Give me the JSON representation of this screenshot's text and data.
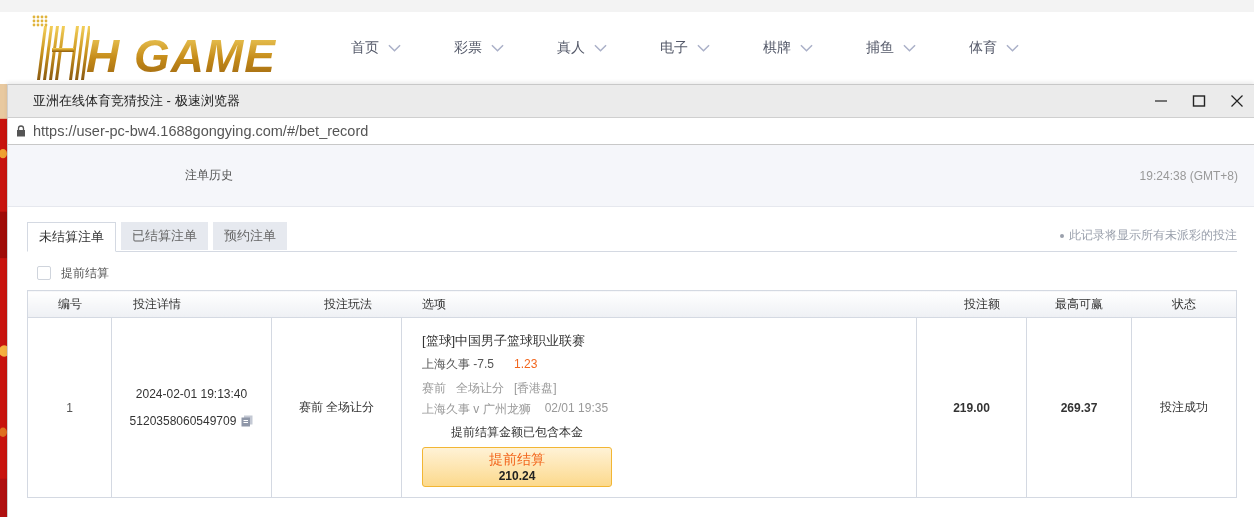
{
  "site_header": {
    "logo_text": "H GAME",
    "nav": [
      {
        "label": "首页"
      },
      {
        "label": "彩票"
      },
      {
        "label": "真人"
      },
      {
        "label": "电子"
      },
      {
        "label": "棋牌"
      },
      {
        "label": "捕鱼"
      },
      {
        "label": "体育"
      }
    ]
  },
  "window": {
    "title": "亚洲在线体育竞猜投注 - 极速浏览器",
    "url": "https://user-pc-bw4.1688gongying.com/#/bet_record"
  },
  "page": {
    "title": "注单历史",
    "clock": "19:24:38 (GMT+8)",
    "tabs": [
      {
        "label": "未结算注单",
        "selected": true
      },
      {
        "label": "已结算注单",
        "selected": false
      },
      {
        "label": "预约注单",
        "selected": false
      }
    ],
    "note": "此记录将显示所有未派彩的投注",
    "filter": {
      "label": "提前结算",
      "checked": false
    },
    "table": {
      "columns": [
        "编号",
        "投注详情",
        "投注玩法",
        "选项",
        "投注额",
        "最高可赢",
        "状态"
      ],
      "rows": [
        {
          "number": "1",
          "time": "2024-02-01 19:13:40",
          "order_id": "5120358060549709",
          "bet_type": "赛前 全场让分",
          "league": "[篮球]中国男子篮球职业联赛",
          "pick": "上海久事 -7.5",
          "odds": "1.23",
          "market": [
            "赛前",
            "全场让分",
            "[香港盘]"
          ],
          "match": "上海久事 v 广州龙狮",
          "match_time": "02/01 19:35",
          "cashout_note": "提前结算金额已包含本金",
          "cashout_label": "提前结算",
          "cashout_amount": "210.24",
          "stake": "219.00",
          "max_win": "269.37",
          "status": "投注成功"
        }
      ]
    }
  }
}
